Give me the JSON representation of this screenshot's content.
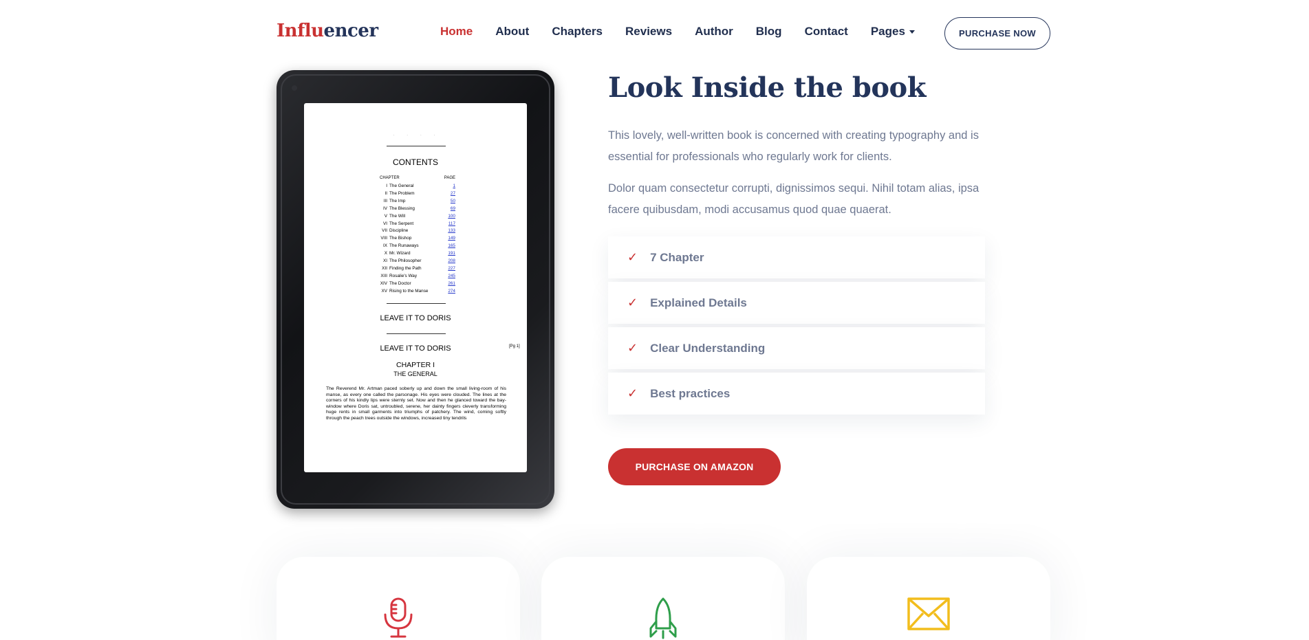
{
  "brand": {
    "part1": "Influ",
    "part2": "encer"
  },
  "nav": {
    "items": [
      {
        "label": "Home",
        "active": true
      },
      {
        "label": "About"
      },
      {
        "label": "Chapters"
      },
      {
        "label": "Reviews"
      },
      {
        "label": "Author"
      },
      {
        "label": "Blog"
      },
      {
        "label": "Contact"
      },
      {
        "label": "Pages",
        "dropdown": true
      }
    ],
    "purchase_label": "PURCHASE NOW"
  },
  "book_screen": {
    "contents_heading": "CONTENTS",
    "col_chapter": "CHAPTER",
    "col_page": "PAGE",
    "toc": [
      {
        "num": "I",
        "title": "The General",
        "page": "1"
      },
      {
        "num": "II",
        "title": "The Problem",
        "page": "27"
      },
      {
        "num": "III",
        "title": "The Imp",
        "page": "50"
      },
      {
        "num": "IV",
        "title": "The Blessing",
        "page": "69"
      },
      {
        "num": "V",
        "title": "The Will",
        "page": "100"
      },
      {
        "num": "VI",
        "title": "The Serpent",
        "page": "117"
      },
      {
        "num": "VII",
        "title": "Discipline",
        "page": "133"
      },
      {
        "num": "VIII",
        "title": "The Bishop",
        "page": "149"
      },
      {
        "num": "IX",
        "title": "The Runaways",
        "page": "165"
      },
      {
        "num": "X",
        "title": "Mr. Wizard",
        "page": "191"
      },
      {
        "num": "XI",
        "title": "The Philosopher",
        "page": "208"
      },
      {
        "num": "XII",
        "title": "Finding the Path",
        "page": "227"
      },
      {
        "num": "XIII",
        "title": "Rosalie's Way",
        "page": "245"
      },
      {
        "num": "XIV",
        "title": "The Doctor",
        "page": "261"
      },
      {
        "num": "XV",
        "title": "Rising to the Manse",
        "page": "274"
      }
    ],
    "heading1": "LEAVE IT TO DORIS",
    "heading2": "LEAVE IT TO DORIS",
    "page_marker": "[Pg 1]",
    "chapter": "CHAPTER I",
    "chapter_title": "THE GENERAL",
    "body": "The Reverend Mr. Artman paced soberly up and down the small living-room of his manse, as every one called the parsonage. His eyes were clouded. The lines at the corners of his kindly lips were sternly set. Now and then he glanced toward the bay-window where Doris sat, untroubled, serene, her dainty fingers cleverly transforming huge rents in small garments into triumphs of patchery. The wind, coming softly through the peach trees outside the windows, increased tiny tendrils"
  },
  "content": {
    "title": "Look Inside the book",
    "para1": "This lovely, well-written book is concerned with creating typography and is essential for professionals who regularly work for clients.",
    "para2": "Dolor quam consectetur corrupti, dignissimos sequi. Nihil totam alias, ipsa facere quibusdam, modi accusamus quod quae quaerat.",
    "features": [
      "7 Chapter",
      "Explained Details",
      "Clear Understanding",
      "Best practices"
    ],
    "cta_label": "PURCHASE ON AMAZON"
  },
  "cards": [
    {
      "icon": "microphone-icon",
      "color": "#d6353f"
    },
    {
      "icon": "rocket-icon",
      "color": "#2e9e4a"
    },
    {
      "icon": "envelope-icon",
      "color": "#f2bd1d"
    }
  ],
  "colors": {
    "accent": "#c93131",
    "navy": "#23345a",
    "muted": "#6e7891"
  }
}
